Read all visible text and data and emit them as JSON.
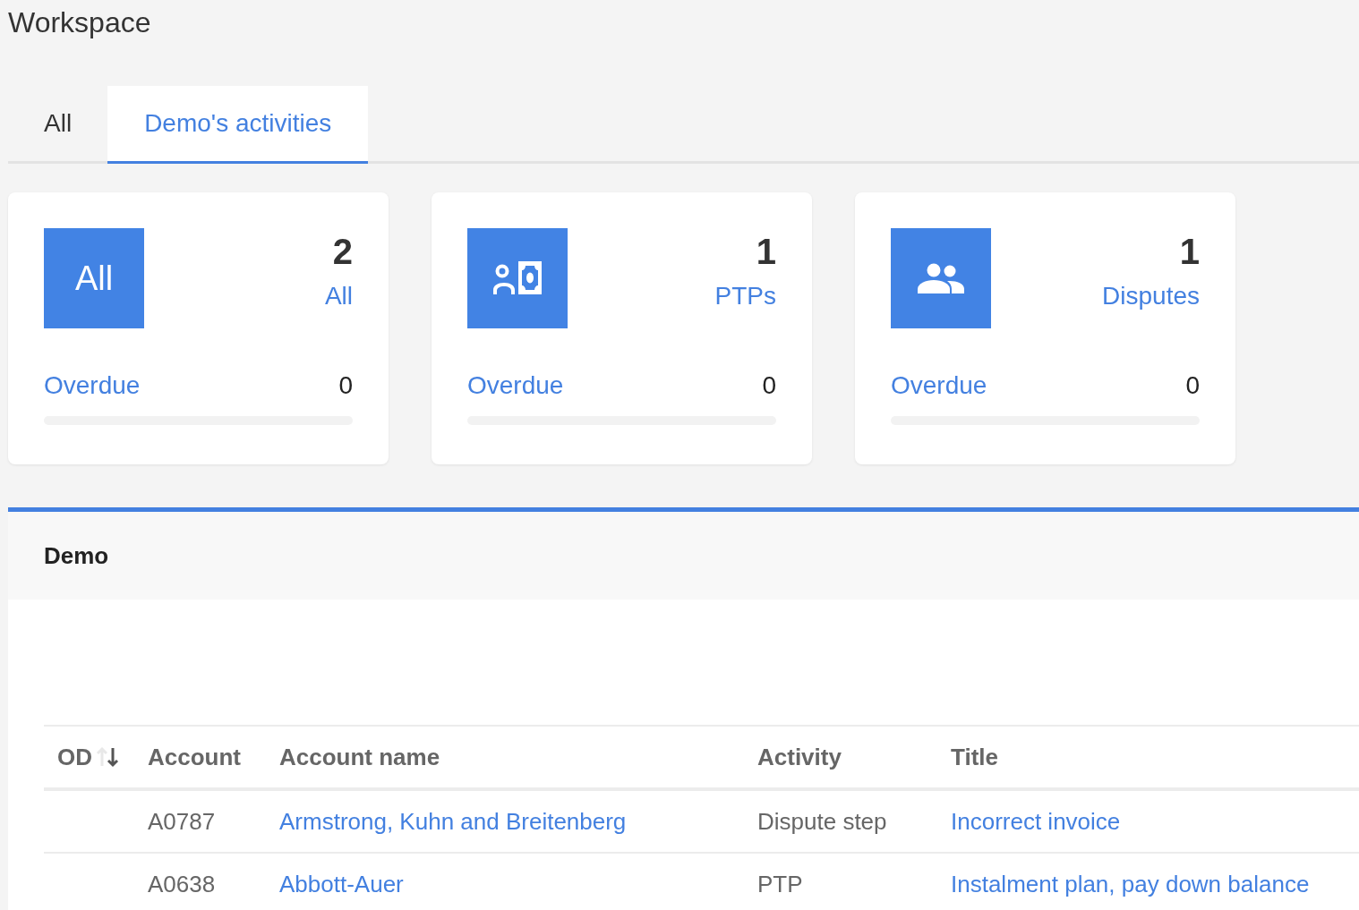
{
  "page_title": "Workspace",
  "tabs": [
    {
      "label": "All",
      "selected": false
    },
    {
      "label": "Demo's activities",
      "selected": true
    }
  ],
  "cards": [
    {
      "kind": "text",
      "icon_text": "All",
      "count": "2",
      "label": "All",
      "overdue_label": "Overdue",
      "overdue_count": "0",
      "level": 0
    },
    {
      "kind": "ptp",
      "count": "1",
      "label": "PTPs",
      "overdue_label": "Overdue",
      "overdue_count": "0",
      "level": 0
    },
    {
      "kind": "dispute",
      "count": "1",
      "label": "Disputes",
      "overdue_label": "Overdue",
      "overdue_count": "0",
      "level": 0
    }
  ],
  "panel": {
    "title": "Demo"
  },
  "table": {
    "columns": [
      {
        "label": "OD",
        "sortable": true
      },
      {
        "label": "Account",
        "sortable": false
      },
      {
        "label": "Account name",
        "sortable": false
      },
      {
        "label": "Activity",
        "sortable": false
      },
      {
        "label": "Title",
        "sortable": false
      }
    ],
    "rows": [
      {
        "account": "A0787",
        "account_name": "Armstrong, Kuhn and Breitenberg",
        "activity": "Dispute step",
        "title": "Incorrect invoice"
      },
      {
        "account": "A0638",
        "account_name": "Abbott-Auer",
        "activity": "PTP",
        "title": "Instalment plan, pay down balance"
      }
    ]
  }
}
